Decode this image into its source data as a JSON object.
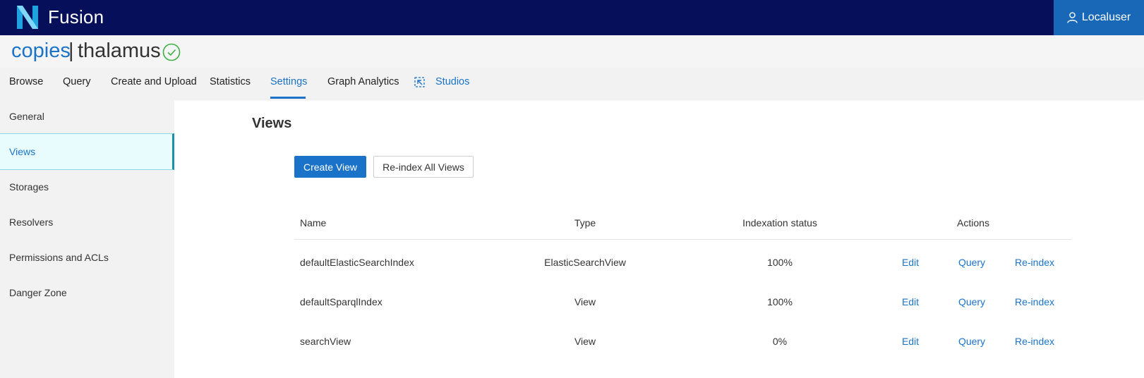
{
  "app": {
    "brand": "Fusion",
    "user_label": "Localuser"
  },
  "project": {
    "org": "copies",
    "separator": "|",
    "name": "thalamus"
  },
  "tabs": [
    {
      "label": "Browse"
    },
    {
      "label": "Query"
    },
    {
      "label": "Create and Upload"
    },
    {
      "label": "Statistics"
    },
    {
      "label": "Settings",
      "active": true
    },
    {
      "label": "Graph Analytics"
    },
    {
      "label": "Studios"
    }
  ],
  "sidebar": {
    "items": [
      {
        "label": "General"
      },
      {
        "label": "Views",
        "active": true
      },
      {
        "label": "Storages"
      },
      {
        "label": "Resolvers"
      },
      {
        "label": "Permissions and ACLs"
      },
      {
        "label": "Danger Zone"
      }
    ]
  },
  "main": {
    "title": "Views",
    "create_button": "Create View",
    "reindex_all_button": "Re-index All Views"
  },
  "table": {
    "headers": {
      "name": "Name",
      "type": "Type",
      "status": "Indexation status",
      "actions": "Actions"
    },
    "rows": [
      {
        "name": "defaultElasticSearchIndex",
        "type": "ElasticSearchView",
        "status": "100%",
        "edit": "Edit",
        "query": "Query",
        "reindex": "Re-index"
      },
      {
        "name": "defaultSparqlIndex",
        "type": "View",
        "status": "100%",
        "edit": "Edit",
        "query": "Query",
        "reindex": "Re-index"
      },
      {
        "name": "searchView",
        "type": "View",
        "status": "0%",
        "edit": "Edit",
        "query": "Query",
        "reindex": "Re-index"
      }
    ]
  },
  "colors": {
    "topbar": "#050f5a",
    "accent": "#1a73c8",
    "success": "#3cb043"
  },
  "icons": {
    "logo": "fusion-logo-icon",
    "user": "user-icon",
    "status": "check-circle-icon",
    "studios": "studios-icon"
  }
}
